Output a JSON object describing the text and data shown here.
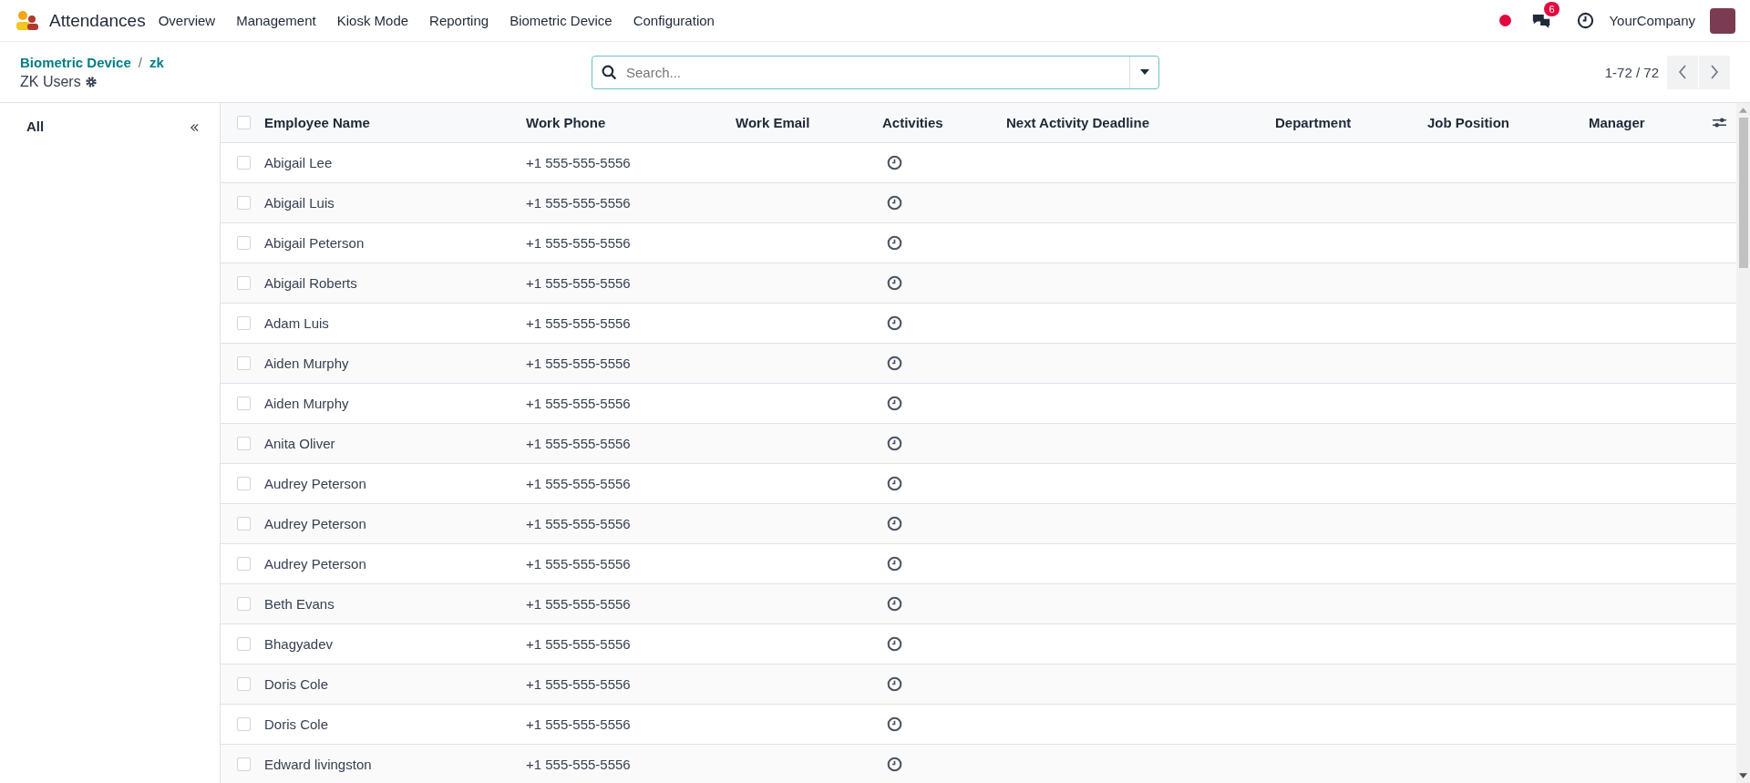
{
  "navbar": {
    "app_name": "Attendances",
    "menu": [
      "Overview",
      "Management",
      "Kiosk Mode",
      "Reporting",
      "Biometric Device",
      "Configuration"
    ],
    "messages_badge": "6",
    "company": "YourCompany"
  },
  "control_panel": {
    "breadcrumbs": [
      "Biometric Device",
      "zk"
    ],
    "breadcrumb_separator": "/",
    "title": "ZK Users",
    "search": {
      "placeholder": "Search..."
    },
    "pager": "1-72 / 72"
  },
  "sidebar": {
    "items": [
      {
        "label": "All",
        "selected": true
      }
    ]
  },
  "table": {
    "select_all_checked": false,
    "columns": [
      "Employee Name",
      "Work Phone",
      "Work Email",
      "Activities",
      "Next Activity Deadline",
      "Department",
      "Job Position",
      "Manager"
    ],
    "rows": [
      {
        "name": "Abigail Lee",
        "phone": "+1 555-555-5556",
        "checked": false
      },
      {
        "name": "Abigail Luis",
        "phone": "+1 555-555-5556",
        "checked": false
      },
      {
        "name": "Abigail Peterson",
        "phone": "+1 555-555-5556",
        "checked": false
      },
      {
        "name": "Abigail Roberts",
        "phone": "+1 555-555-5556",
        "checked": false
      },
      {
        "name": "Adam Luis",
        "phone": "+1 555-555-5556",
        "checked": false
      },
      {
        "name": "Aiden Murphy",
        "phone": "+1 555-555-5556",
        "checked": false
      },
      {
        "name": "Aiden Murphy",
        "phone": "+1 555-555-5556",
        "checked": false
      },
      {
        "name": "Anita Oliver",
        "phone": "+1 555-555-5556",
        "checked": false
      },
      {
        "name": "Audrey Peterson",
        "phone": "+1 555-555-5556",
        "checked": false
      },
      {
        "name": "Audrey Peterson",
        "phone": "+1 555-555-5556",
        "checked": false
      },
      {
        "name": "Audrey Peterson",
        "phone": "+1 555-555-5556",
        "checked": false
      },
      {
        "name": "Beth Evans",
        "phone": "+1 555-555-5556",
        "checked": false
      },
      {
        "name": "Bhagyadev",
        "phone": "+1 555-555-5556",
        "checked": false
      },
      {
        "name": "Doris Cole",
        "phone": "+1 555-555-5556",
        "checked": false
      },
      {
        "name": "Doris Cole",
        "phone": "+1 555-555-5556",
        "checked": false
      },
      {
        "name": "Edward livingston",
        "phone": "+1 555-555-5556",
        "checked": false
      }
    ]
  }
}
